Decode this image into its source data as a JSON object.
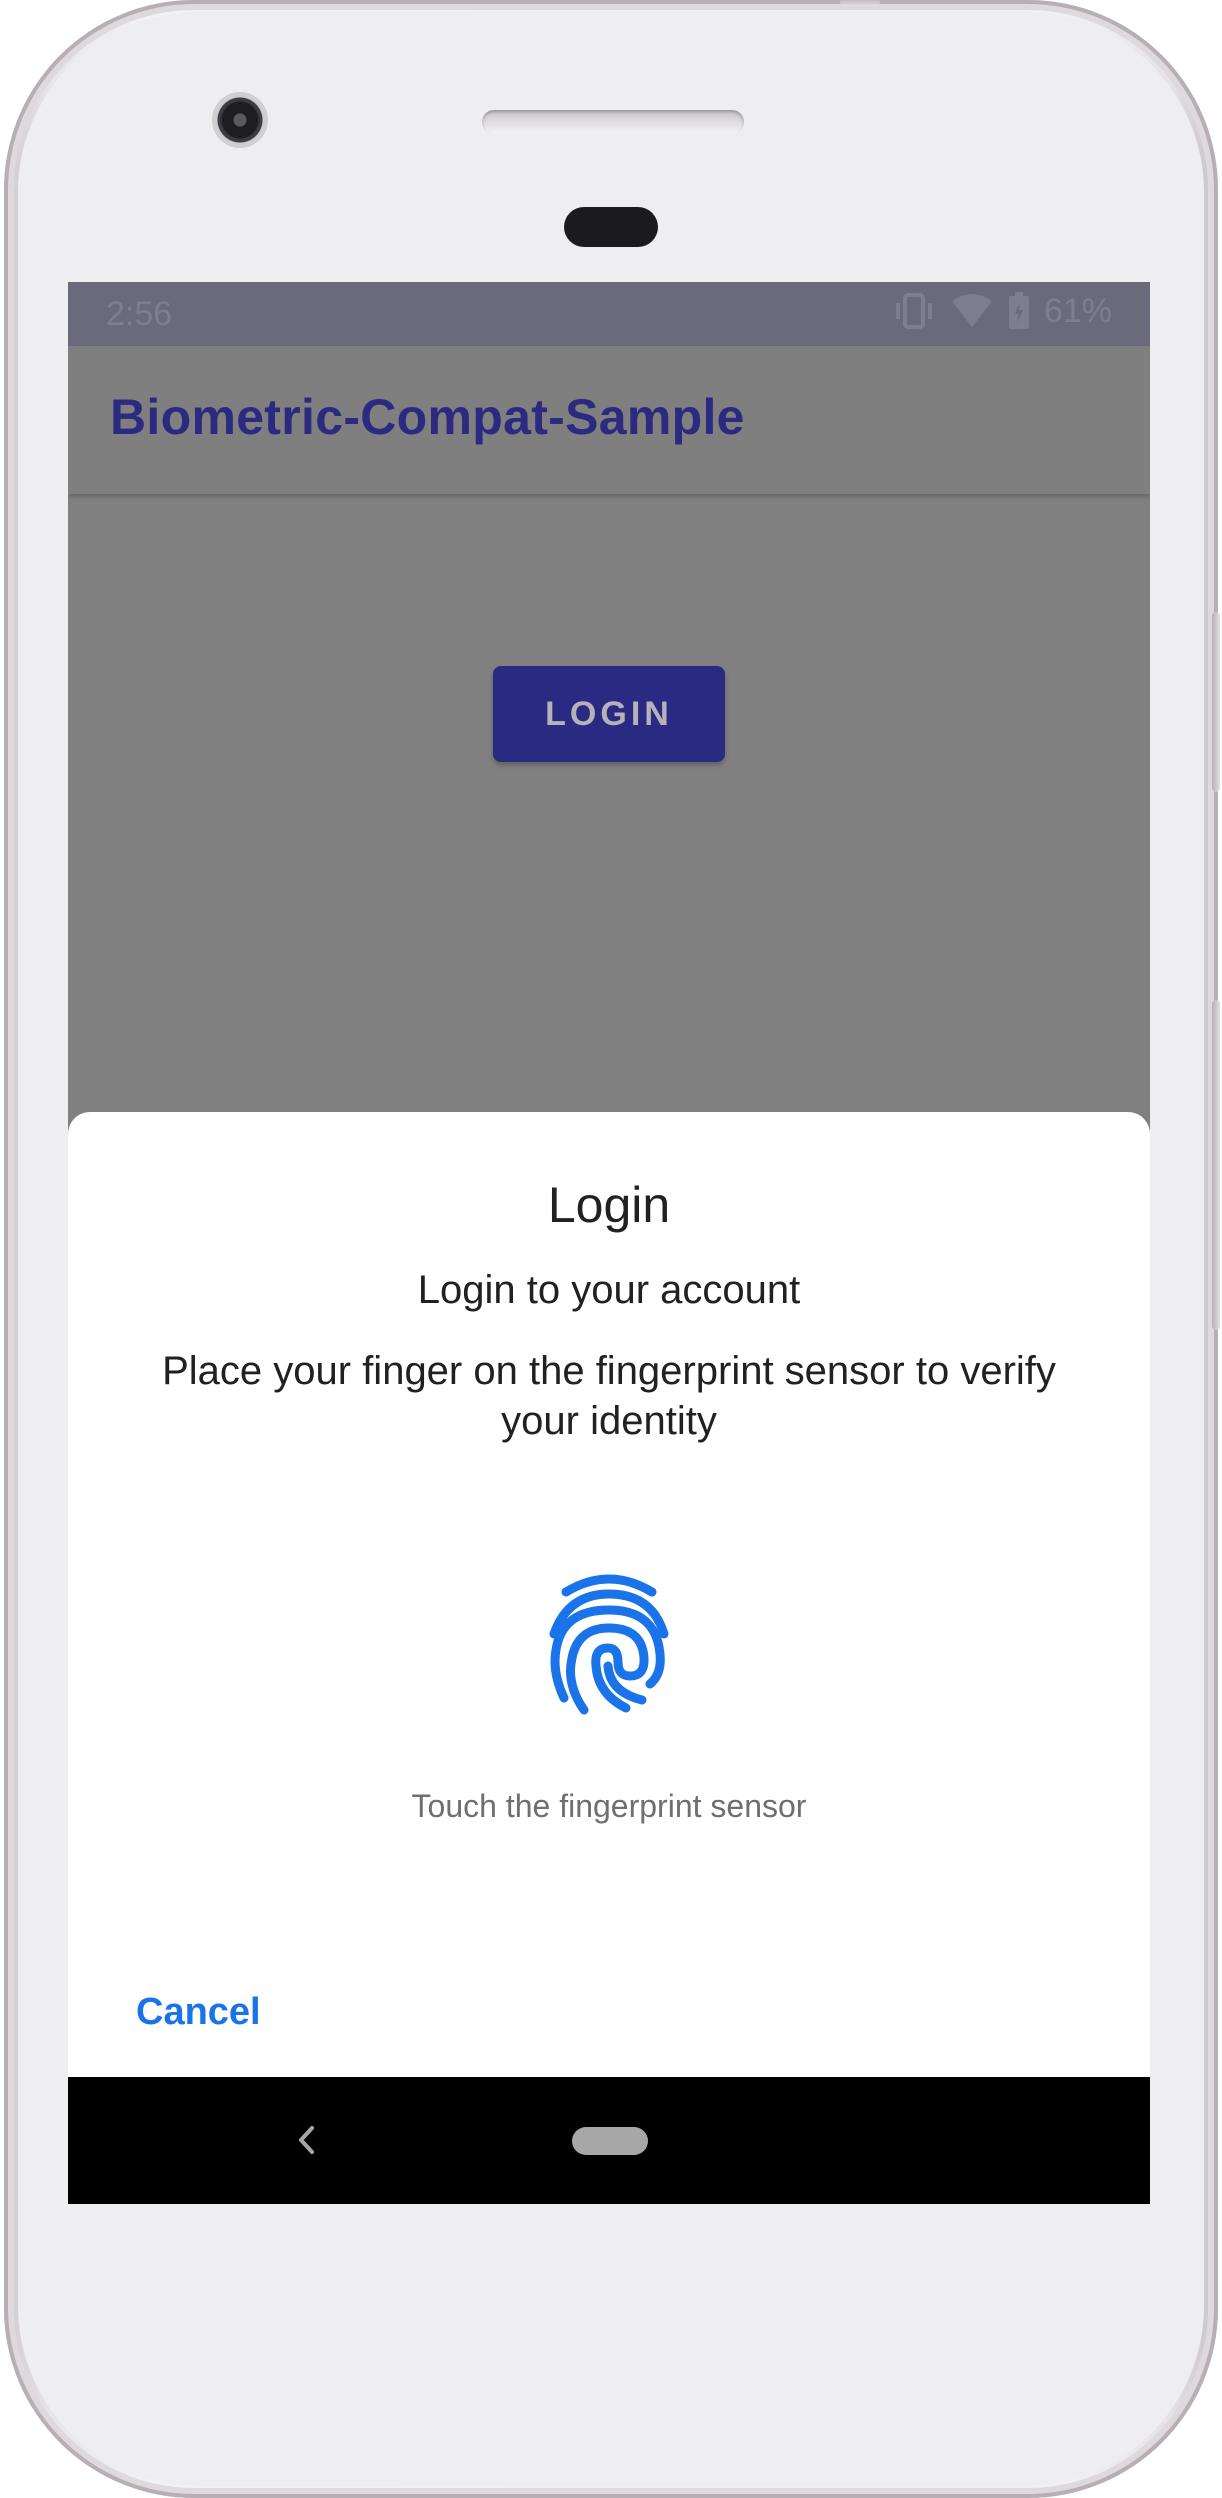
{
  "status_bar": {
    "time": "2:56",
    "battery": "61%",
    "icons": [
      "vibrate-icon",
      "wifi-icon",
      "battery-icon"
    ]
  },
  "app_bar": {
    "title": "Biometric-Compat-Sample"
  },
  "main": {
    "login_button": "LOGIN"
  },
  "dialog": {
    "title": "Login",
    "subtitle": "Login to your account",
    "description": "Place your finger on the fingerprint sensor to verify your identity",
    "status": "Touch the fingerprint sensor",
    "cancel": "Cancel",
    "icon": "fingerprint-icon"
  },
  "nav_bar": {
    "icons": [
      "back-icon",
      "home-icon"
    ]
  },
  "colors": {
    "app_title": "#2C2A80",
    "login_button_bg": "#2B2A82",
    "accent": "#1A73E8",
    "scrim": "#808080",
    "status_bar": "#6A6A7B"
  }
}
